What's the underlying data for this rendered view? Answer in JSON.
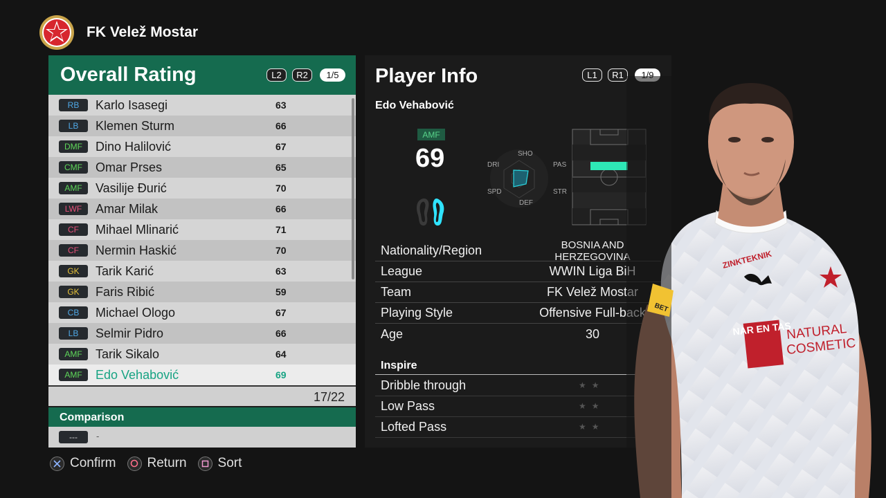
{
  "club": {
    "name": "FK Velež Mostar"
  },
  "left_panel": {
    "title": "Overall Rating",
    "buttons": [
      "L2",
      "R2"
    ],
    "page": "1/5",
    "players": [
      {
        "pos": "RB",
        "pos_color": "#4fa8e6",
        "name": "Karlo Isasegi",
        "rating": "63"
      },
      {
        "pos": "LB",
        "pos_color": "#4fa8e6",
        "name": "Klemen Sturm",
        "rating": "66"
      },
      {
        "pos": "DMF",
        "pos_color": "#5fd85a",
        "name": "Dino Halilović",
        "rating": "67"
      },
      {
        "pos": "CMF",
        "pos_color": "#5fd85a",
        "name": "Omar Prses",
        "rating": "65"
      },
      {
        "pos": "AMF",
        "pos_color": "#5fd85a",
        "name": "Vasilije Đurić",
        "rating": "70"
      },
      {
        "pos": "LWF",
        "pos_color": "#e8507a",
        "name": "Amar Milak",
        "rating": "66"
      },
      {
        "pos": "CF",
        "pos_color": "#e8507a",
        "name": "Mihael Mlinarić",
        "rating": "71"
      },
      {
        "pos": "CF",
        "pos_color": "#e8507a",
        "name": "Nermin Haskić",
        "rating": "70"
      },
      {
        "pos": "GK",
        "pos_color": "#e8c33a",
        "name": "Tarik Karić",
        "rating": "63"
      },
      {
        "pos": "GK",
        "pos_color": "#e8c33a",
        "name": "Faris Ribić",
        "rating": "59"
      },
      {
        "pos": "CB",
        "pos_color": "#4fa8e6",
        "name": "Michael Ologo",
        "rating": "67"
      },
      {
        "pos": "LB",
        "pos_color": "#4fa8e6",
        "name": "Selmir Pidro",
        "rating": "66"
      },
      {
        "pos": "AMF",
        "pos_color": "#5fd85a",
        "name": "Tarik Sikalo",
        "rating": "64"
      },
      {
        "pos": "AMF",
        "pos_color": "#5fd85a",
        "name": "Edo Vehabović",
        "rating": "69",
        "selected": true
      }
    ],
    "count": "17/22",
    "comparison": {
      "title": "Comparison",
      "badge": "---",
      "value": "-"
    }
  },
  "footer": {
    "confirm": "Confirm",
    "return": "Return",
    "sort": "Sort"
  },
  "right_panel": {
    "title": "Player Info",
    "buttons": [
      "L1",
      "R1"
    ],
    "page": "1/9",
    "player_name": "Edo Vehabović",
    "position": "AMF",
    "overall": "69",
    "radar_labels": {
      "sho": "SHO",
      "pas": "PAS",
      "str": "STR",
      "def": "DEF",
      "spd": "SPD",
      "dri": "DRI"
    },
    "info": [
      {
        "label": "Nationality/Region",
        "value": "BOSNIA AND HERZEGOVINA"
      },
      {
        "label": "League",
        "value": "WWIN Liga BiH"
      },
      {
        "label": "Team",
        "value": "FK Velež Mostar"
      },
      {
        "label": "Playing Style",
        "value": "Offensive Full-back"
      },
      {
        "label": "Age",
        "value": "30"
      }
    ],
    "inspire_title": "Inspire",
    "inspire": [
      {
        "label": "Dribble through",
        "stars": "★★"
      },
      {
        "label": "Low Pass",
        "stars": "★★"
      },
      {
        "label": "Lofted Pass",
        "stars": "★★"
      }
    ]
  },
  "kit": {
    "sponsor_top": "ZINKTEKNIK",
    "sponsor_logo": "NAR EN TAS",
    "sponsor_text_1": "NATURAL",
    "sponsor_text_2": "COSMETIC",
    "sleeve": "BET"
  },
  "colors": {
    "accent_green": "#156b4f",
    "selected_text": "#17a383",
    "highlight_zone": "#2ee8b6"
  }
}
